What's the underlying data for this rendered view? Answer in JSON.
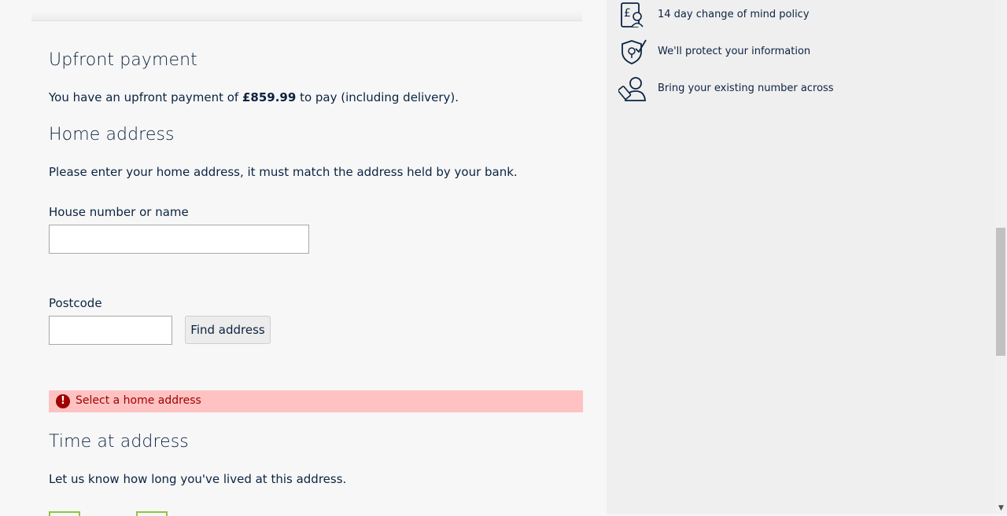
{
  "upfront": {
    "heading": "Upfront payment",
    "text_before": "You have an upfront payment of ",
    "amount": "£859.99",
    "text_after": " to pay (including delivery)."
  },
  "home_address": {
    "heading": "Home address",
    "intro": "Please enter your home address, it must match the address held by your bank.",
    "house_label": "House number or name",
    "house_value": "",
    "postcode_label": "Postcode",
    "postcode_value": "",
    "find_button": "Find address",
    "error": "Select a home address"
  },
  "time_at_address": {
    "heading": "Time at address",
    "intro": "Let us know how long you've lived at this address."
  },
  "sidebar": {
    "features": [
      {
        "icon": "pound-document-icon",
        "label": "14 day change of mind policy"
      },
      {
        "icon": "shield-check-icon",
        "label": "We'll protect your information"
      },
      {
        "icon": "person-phone-icon",
        "label": "Bring your existing number across"
      }
    ]
  },
  "colors": {
    "text": "#0b2341",
    "error_bg": "#ffc2c2",
    "error_text": "#a00000",
    "accent_green": "#8dc63f"
  }
}
